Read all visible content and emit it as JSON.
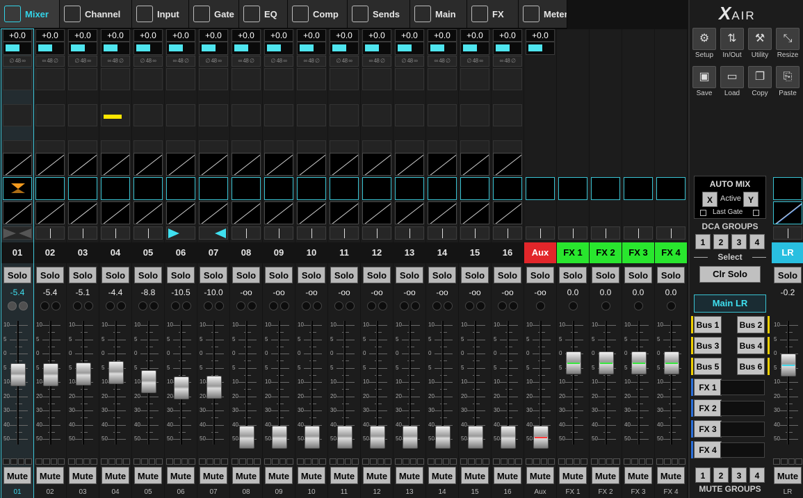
{
  "tabs": [
    {
      "label": "Mixer",
      "icon": "mixer-icon"
    },
    {
      "label": "Channel",
      "icon": "channel-icon"
    },
    {
      "label": "Input",
      "icon": "input-icon"
    },
    {
      "label": "Gate",
      "icon": "gate-icon"
    },
    {
      "label": "EQ",
      "icon": "eq-icon"
    },
    {
      "label": "Comp",
      "icon": "comp-icon"
    },
    {
      "label": "Sends",
      "icon": "sends-icon"
    },
    {
      "label": "Main",
      "icon": "main-icon"
    },
    {
      "label": "FX",
      "icon": "fx-icon"
    },
    {
      "label": "Meter",
      "icon": "meter-icon"
    }
  ],
  "strips": [
    {
      "gain": "+0.0",
      "meter": 0.55,
      "flags": "∅ 48 ∞",
      "name": "01",
      "solo": "Solo",
      "level": "-5.4",
      "mute": "Mute",
      "foot": "01",
      "fader": 0.62
    },
    {
      "gain": "+0.0",
      "meter": 0.55,
      "flags": "∞ 48 ∅",
      "name": "02",
      "solo": "Solo",
      "level": "-5.4",
      "mute": "Mute",
      "foot": "02",
      "fader": 0.62
    },
    {
      "gain": "+0.0",
      "meter": 0.55,
      "flags": "∅ 48 ∞",
      "name": "03",
      "solo": "Solo",
      "level": "-5.1",
      "mute": "Mute",
      "foot": "03",
      "fader": 0.63
    },
    {
      "gain": "+0.0",
      "meter": 0.55,
      "flags": "∞ 48 ∅",
      "name": "04",
      "solo": "Solo",
      "level": "-4.4",
      "mute": "Mute",
      "foot": "04",
      "fader": 0.64
    },
    {
      "gain": "+0.0",
      "meter": 0.55,
      "flags": "∅ 48 ∞",
      "name": "05",
      "solo": "Solo",
      "level": "-8.8",
      "mute": "Mute",
      "foot": "05",
      "fader": 0.55
    },
    {
      "gain": "+0.0",
      "meter": 0.55,
      "flags": "∞ 48 ∅",
      "name": "06",
      "solo": "Solo",
      "level": "-10.5",
      "mute": "Mute",
      "foot": "06",
      "fader": 0.49
    },
    {
      "gain": "+0.0",
      "meter": 0.55,
      "flags": "∅ 48 ∞",
      "name": "07",
      "solo": "Solo",
      "level": "-10.0",
      "mute": "Mute",
      "foot": "07",
      "fader": 0.5
    },
    {
      "gain": "+0.0",
      "meter": 0.55,
      "flags": "∞ 48 ∅",
      "name": "08",
      "solo": "Solo",
      "level": "-oo",
      "mute": "Mute",
      "foot": "08",
      "fader": 0.0
    },
    {
      "gain": "+0.0",
      "meter": 0.55,
      "flags": "∅ 48 ∞",
      "name": "09",
      "solo": "Solo",
      "level": "-oo",
      "mute": "Mute",
      "foot": "09",
      "fader": 0.0
    },
    {
      "gain": "+0.0",
      "meter": 0.55,
      "flags": "∞ 48 ∅",
      "name": "10",
      "solo": "Solo",
      "level": "-oo",
      "mute": "Mute",
      "foot": "10",
      "fader": 0.0
    },
    {
      "gain": "+0.0",
      "meter": 0.55,
      "flags": "∅ 48 ∞",
      "name": "11",
      "solo": "Solo",
      "level": "-oo",
      "mute": "Mute",
      "foot": "11",
      "fader": 0.0
    },
    {
      "gain": "+0.0",
      "meter": 0.55,
      "flags": "∞ 48 ∅",
      "name": "12",
      "solo": "Solo",
      "level": "-oo",
      "mute": "Mute",
      "foot": "12",
      "fader": 0.0
    },
    {
      "gain": "+0.0",
      "meter": 0.55,
      "flags": "∅ 48 ∞",
      "name": "13",
      "solo": "Solo",
      "level": "-oo",
      "mute": "Mute",
      "foot": "13",
      "fader": 0.0
    },
    {
      "gain": "+0.0",
      "meter": 0.55,
      "flags": "∞ 48 ∅",
      "name": "14",
      "solo": "Solo",
      "level": "-oo",
      "mute": "Mute",
      "foot": "14",
      "fader": 0.0
    },
    {
      "gain": "+0.0",
      "meter": 0.55,
      "flags": "∅ 48 ∞",
      "name": "15",
      "solo": "Solo",
      "level": "-oo",
      "mute": "Mute",
      "foot": "15",
      "fader": 0.0
    },
    {
      "gain": "+0.0",
      "meter": 0.55,
      "flags": "∞ 48 ∅",
      "name": "16",
      "solo": "Solo",
      "level": "-oo",
      "mute": "Mute",
      "foot": "16",
      "fader": 0.0
    },
    {
      "gain": "+0.0",
      "meter": 0.55,
      "flags": "",
      "name": "Aux",
      "solo": "Solo",
      "level": "-oo",
      "mute": "Mute",
      "foot": "Aux",
      "fader": 0.0
    },
    {
      "gain": "",
      "meter": 0,
      "flags": "",
      "name": "FX 1",
      "solo": "Solo",
      "level": "0.0",
      "mute": "Mute",
      "foot": "FX 1",
      "fader": 0.74
    },
    {
      "gain": "",
      "meter": 0,
      "flags": "",
      "name": "FX 2",
      "solo": "Solo",
      "level": "0.0",
      "mute": "Mute",
      "foot": "FX 2",
      "fader": 0.74
    },
    {
      "gain": "",
      "meter": 0,
      "flags": "",
      "name": "FX 3",
      "solo": "Solo",
      "level": "0.0",
      "mute": "Mute",
      "foot": "FX 3",
      "fader": 0.74
    },
    {
      "gain": "",
      "meter": 0,
      "flags": "",
      "name": "FX 4",
      "solo": "Solo",
      "level": "0.0",
      "mute": "Mute",
      "foot": "FX 4",
      "fader": 0.74
    }
  ],
  "scale_labels": [
    "10",
    "5",
    "0",
    "5",
    "10",
    "20",
    "30",
    "40",
    "50"
  ],
  "right": {
    "logo": "X",
    "logo_suffix": "AIR",
    "utils": [
      {
        "label": "Setup",
        "icon": "gear-icon",
        "glyph": "⚙"
      },
      {
        "label": "In/Out",
        "icon": "in-out-icon",
        "glyph": "⇅"
      },
      {
        "label": "Utility",
        "icon": "wrench-icon",
        "glyph": "⚒"
      },
      {
        "label": "Resize",
        "icon": "resize-icon",
        "glyph": "⤡"
      },
      {
        "label": "Save",
        "icon": "save-icon",
        "glyph": "▣"
      },
      {
        "label": "Load",
        "icon": "folder-icon",
        "glyph": "▭"
      },
      {
        "label": "Copy",
        "icon": "copy-icon",
        "glyph": "❐"
      },
      {
        "label": "Paste",
        "icon": "paste-icon",
        "glyph": "⎘"
      }
    ],
    "automix": {
      "title": "AUTO MIX",
      "x": "X",
      "active": "Active",
      "y": "Y",
      "last_gate": "Last Gate"
    },
    "dca_title": "DCA GROUPS",
    "dca": [
      "1",
      "2",
      "3",
      "4"
    ],
    "select": "Select",
    "clr_solo": "Clr Solo",
    "main_lr": "Main LR",
    "buses": [
      "Bus 1",
      "Bus 2",
      "Bus 3",
      "Bus 4",
      "Bus 5",
      "Bus 6"
    ],
    "fx": [
      "FX 1",
      "FX 2",
      "FX 3",
      "FX 4"
    ],
    "mute_groups": [
      "1",
      "2",
      "3",
      "4"
    ],
    "mute_groups_title": "MUTE GROUPS",
    "lr": {
      "name": "LR",
      "solo": "Solo",
      "level": "-0.2",
      "mute": "Mute",
      "foot": "LR",
      "fader": 0.72
    }
  },
  "colors": {
    "accent": "#33d4e8",
    "aux": "#e2262a",
    "fx": "#29e62e",
    "lr": "#29bfe0",
    "bus_marker": "#f0d000",
    "fx_marker": "#2b6ed8"
  }
}
